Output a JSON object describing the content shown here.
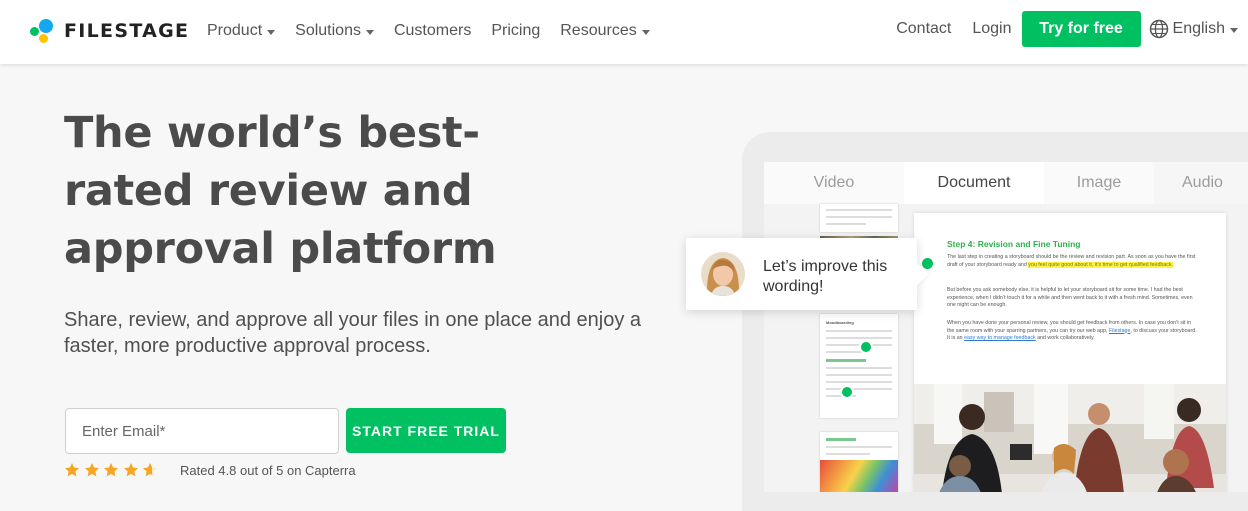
{
  "brand": {
    "name": "FILESTAGE",
    "accent": "#00c061",
    "blue": "#14a7f2",
    "yellow": "#ffc100"
  },
  "nav": {
    "items": [
      {
        "label": "Product",
        "dropdown": true
      },
      {
        "label": "Solutions",
        "dropdown": true
      },
      {
        "label": "Customers",
        "dropdown": false
      },
      {
        "label": "Pricing",
        "dropdown": false
      },
      {
        "label": "Resources",
        "dropdown": true
      }
    ],
    "contact": "Contact",
    "login": "Login",
    "cta": "Try for free",
    "language": "English"
  },
  "hero": {
    "title": "The world’s best-rated review and approval platform",
    "subtitle": "Share, review, and approve all your files in one place and enjoy a faster, more productive approval process.",
    "email_placeholder": "Enter Email*",
    "cta": "START FREE TRIAL",
    "rating_text": "Rated 4.8 out of 5 on Capterra",
    "rating_value": 4.8,
    "rating_max": 5
  },
  "mockup": {
    "tabs": [
      {
        "label": "Video",
        "active": false
      },
      {
        "label": "Document",
        "active": true
      },
      {
        "label": "Image",
        "active": false
      },
      {
        "label": "Audio",
        "active": false
      }
    ],
    "thumb_heading": "Moodboarding",
    "doc": {
      "heading": "Step 4: Revision and Fine Tuning",
      "p1_a": "The last step in creating a storyboard should be the review and revision part. As soon as you have the first draft of your storyboard ready and ",
      "p1_highlight": "you feel quite good about it, it’s time to get qualified feedback.",
      "p2": "But before you ask somebody else, it is helpful to let your storyboard sit for some time. I had the best experience, when I didn’t touch it for a while and then went back to it with a fresh mind. Sometimes, even one night can be enough.",
      "p3_a": "When you have done your personal review, you should get feedback from others. In case you don’t sit in the same room with your sparring partners, you can try our web app, ",
      "p3_link1": "Filestage",
      "p3_b": ", to discuss your storyboard. It is an ",
      "p3_link2": "easy way to manage feedback",
      "p3_c": " and work collaboratively."
    },
    "comment": "Let’s improve this wording!"
  }
}
